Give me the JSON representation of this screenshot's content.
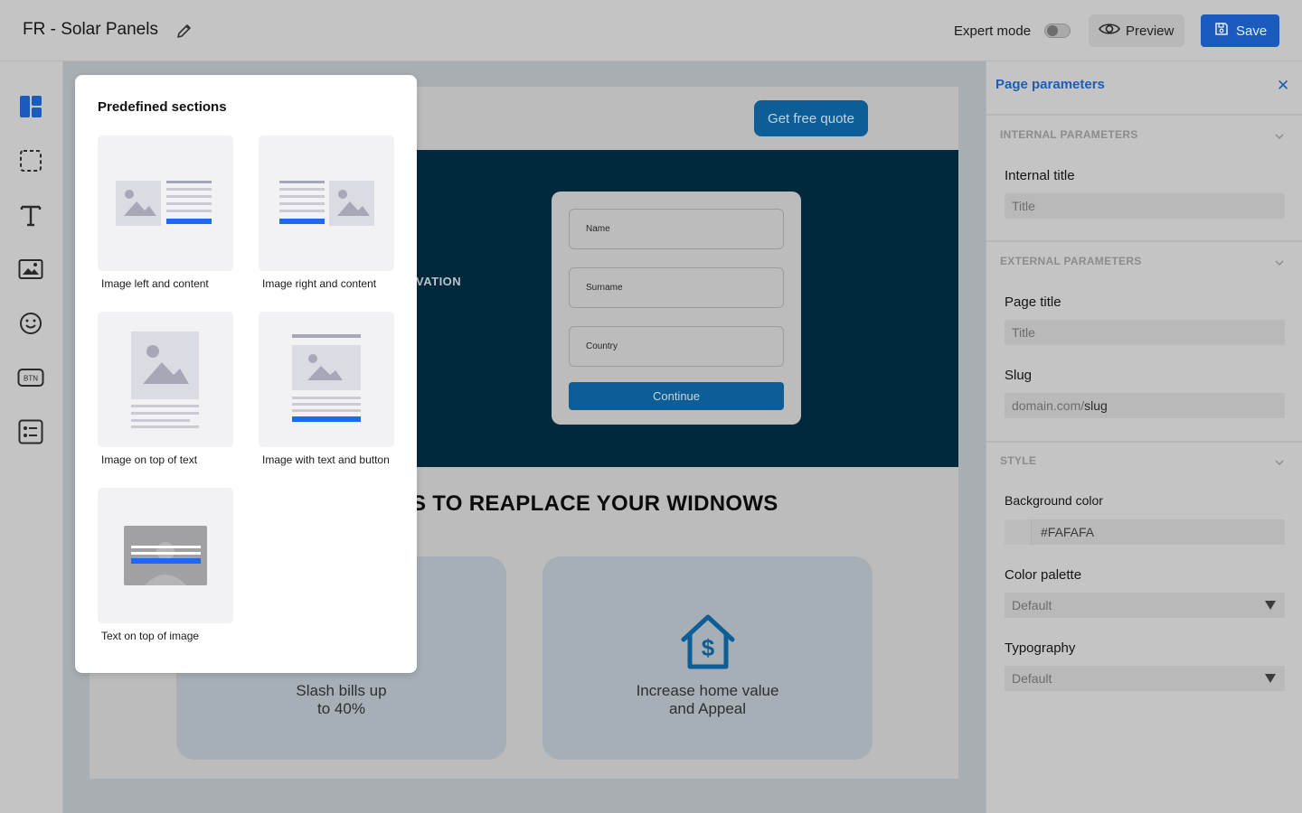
{
  "topbar": {
    "title": "FR - Solar Panels",
    "expert_mode_label": "Expert mode",
    "expert_mode_on": false,
    "preview_label": "Preview",
    "save_label": "Save"
  },
  "left_toolbar": {
    "tools": [
      "layout-icon",
      "section-select-icon",
      "text-icon",
      "image-icon",
      "emoji-icon",
      "button-icon",
      "form-icon"
    ]
  },
  "canvas": {
    "header_button": "Get free quote",
    "hero_text": "VATION",
    "form": {
      "fields": [
        "Name",
        "Surname",
        "Country"
      ],
      "submit": "Continue"
    },
    "section_title": "S TO REAPLACE YOUR WIDNOWS",
    "cards": [
      {
        "text_line1": "Slash bills up",
        "text_line2": "to 40%"
      },
      {
        "text_line1": "Increase home value",
        "text_line2": "and Appeal"
      }
    ]
  },
  "predefined": {
    "title": "Predefined sections",
    "items": [
      "Image left and content",
      "Image right and content",
      "Image on top of text",
      "Image with text and button",
      "Text on top of image"
    ]
  },
  "right_panel": {
    "title": "Page parameters",
    "internal": {
      "section": "INTERNAL PARAMETERS",
      "title_label": "Internal title",
      "title_placeholder": "Title"
    },
    "external": {
      "section": "EXTERNAL PARAMETERS",
      "page_title_label": "Page title",
      "page_title_placeholder": "Title",
      "slug_label": "Slug",
      "slug_prefix": "domain.com/",
      "slug_value": "slug"
    },
    "style": {
      "section": "STYLE",
      "bg_label": "Background color",
      "bg_value": "#FAFAFA",
      "palette_label": "Color palette",
      "palette_value": "Default",
      "typography_label": "Typography",
      "typography_value": "Default"
    }
  },
  "colors": {
    "accent": "#1a5bbd",
    "hero_bg": "#00293c",
    "cta": "#0d5e96"
  }
}
